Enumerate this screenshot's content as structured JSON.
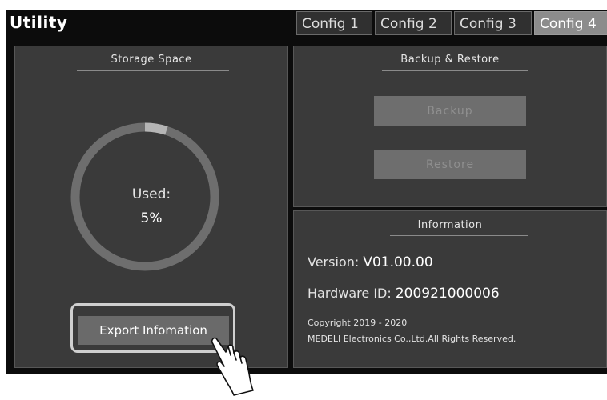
{
  "header": {
    "title": "Utility",
    "tabs": [
      {
        "label": "Config 1",
        "active": false
      },
      {
        "label": "Config 2",
        "active": false
      },
      {
        "label": "Config 3",
        "active": false
      },
      {
        "label": "Config 4",
        "active": true
      }
    ]
  },
  "storage": {
    "title": "Storage Space",
    "used_label": "Used:",
    "used_value": "5%",
    "used_fraction": 0.05,
    "export_button": "Export Infomation"
  },
  "backup": {
    "title": "Backup & Restore",
    "backup_button": "Backup",
    "restore_button": "Restore"
  },
  "information": {
    "title": "Information",
    "version_label": "Version:",
    "version_value": "V01.00.00",
    "hardware_label": "Hardware ID:",
    "hardware_value": "200921000006",
    "copyright_line1": "Copyright 2019 - 2020",
    "copyright_line2": "MEDELI Electronics Co.,Ltd.All Rights Reserved."
  },
  "colors": {
    "ring_track": "#6e6e6e",
    "ring_used": "#b5b5b5",
    "panel_bg": "#3a3a3a",
    "active_tab": "#8c8c8c"
  },
  "icons": {
    "pointer": "hand-pointer-icon"
  }
}
